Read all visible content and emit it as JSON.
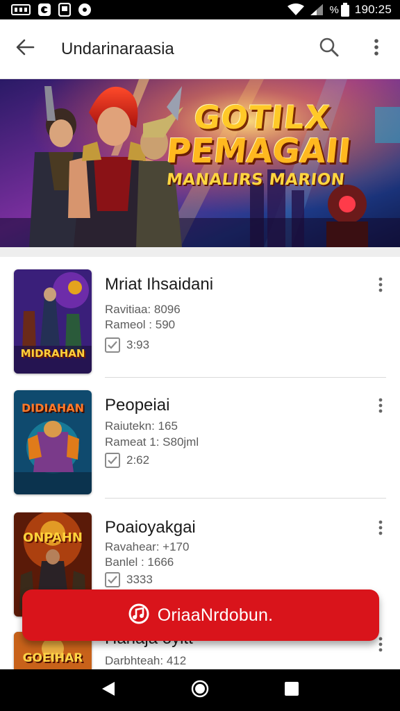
{
  "status_bar": {
    "time": "190:25",
    "notification_icons": [
      "sim-card-icon",
      "app-notification-icon",
      "tablet-icon",
      "chat-icon"
    ],
    "system_icons": [
      "wifi-icon",
      "signal-icon",
      "battery-icon"
    ],
    "battery_label": "%"
  },
  "app_bar": {
    "title": "Undarinaraasia",
    "back_icon": "arrow-back-icon",
    "search_icon": "search-icon",
    "more_icon": "more-vert-icon"
  },
  "banner": {
    "line1": "GOTILX",
    "line2": "PEMAGAII",
    "line3": "MANALIRS MARION"
  },
  "games": [
    {
      "title": "Mriat Ihsaidani",
      "line1": "Ravitiaa: 8096",
      "line2": "Rameol : 590",
      "check_value": "3:93",
      "thumb_text": "MIDRAHAN",
      "thumb_colors": [
        "#3a1f7a",
        "#7b2fb5",
        "#e4a31e"
      ]
    },
    {
      "title": "Peopeiai",
      "line1": "Raiutekn: 165",
      "line2": "Rameat 1: S80jml",
      "check_value": "2:62",
      "thumb_text": "DIDIAHAN",
      "thumb_colors": [
        "#0f4a6e",
        "#1b8fa8",
        "#e07b1a"
      ]
    },
    {
      "title": "Poaioyakgai",
      "line1": "Ravahear: +170",
      "line2": "Banlel : 1666",
      "check_value": "3333",
      "thumb_text": "ONPAHN",
      "thumb_colors": [
        "#5a1a08",
        "#c14a12",
        "#f0b02a"
      ]
    },
    {
      "title": "Hanaja oyitt",
      "line1": "Darbhteah: 412",
      "line2": "",
      "check_value": "",
      "thumb_text": "GOEIHAR",
      "thumb_colors": [
        "#6b2a0a",
        "#c8621a",
        "#f3c24a"
      ]
    }
  ],
  "cta": {
    "label": "OriaaNrdobun.",
    "icon": "music-note-icon"
  },
  "nav_bar": {
    "back_icon": "nav-back-icon",
    "home_icon": "nav-home-icon",
    "recents_icon": "nav-recents-icon"
  },
  "colors": {
    "accent": "#d9141b",
    "status_bar": "#000000",
    "divider": "#dadada"
  }
}
